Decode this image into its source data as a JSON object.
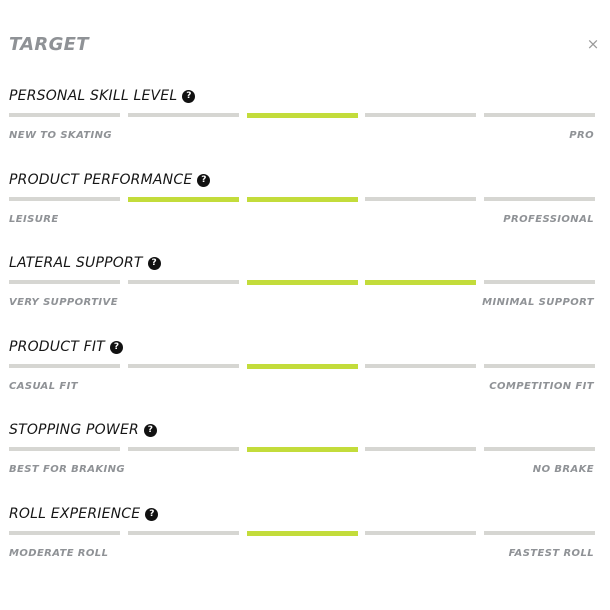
{
  "header": {
    "title": "TARGET",
    "close_label": "×"
  },
  "attributes": [
    {
      "label": "PERSONAL SKILL LEVEL",
      "help_icon": "question-circle-icon",
      "help_glyph": "?",
      "left": "NEW TO SKATING",
      "right": "PRO",
      "active_segments": [
        3
      ]
    },
    {
      "label": "PRODUCT PERFORMANCE",
      "help_icon": "question-circle-icon",
      "help_glyph": "?",
      "left": "LEISURE",
      "right": "PROFESSIONAL",
      "active_segments": [
        2,
        3
      ]
    },
    {
      "label": "LATERAL SUPPORT",
      "help_icon": "question-circle-icon",
      "help_glyph": "?",
      "left": "VERY SUPPORTIVE",
      "right": "MINIMAL SUPPORT",
      "active_segments": [
        3,
        4
      ]
    },
    {
      "label": "PRODUCT FIT",
      "help_icon": "question-circle-icon",
      "help_glyph": "?",
      "left": "CASUAL FIT",
      "right": "COMPETITION FIT",
      "active_segments": [
        3
      ]
    },
    {
      "label": "STOPPING POWER",
      "help_icon": "question-circle-icon",
      "help_glyph": "?",
      "left": "BEST FOR BRAKING",
      "right": "NO BRAKE",
      "active_segments": [
        3
      ]
    },
    {
      "label": "ROLL EXPERIENCE",
      "help_icon": "question-circle-icon",
      "help_glyph": "?",
      "left": "MODERATE ROLL",
      "right": "FASTEST ROLL",
      "active_segments": [
        3
      ]
    }
  ],
  "scale_segment_count": 5,
  "colors": {
    "active": "#c3dc3b",
    "inactive": "#d6d6d2",
    "muted_text": "#8f9296",
    "help_bg": "#111111"
  }
}
